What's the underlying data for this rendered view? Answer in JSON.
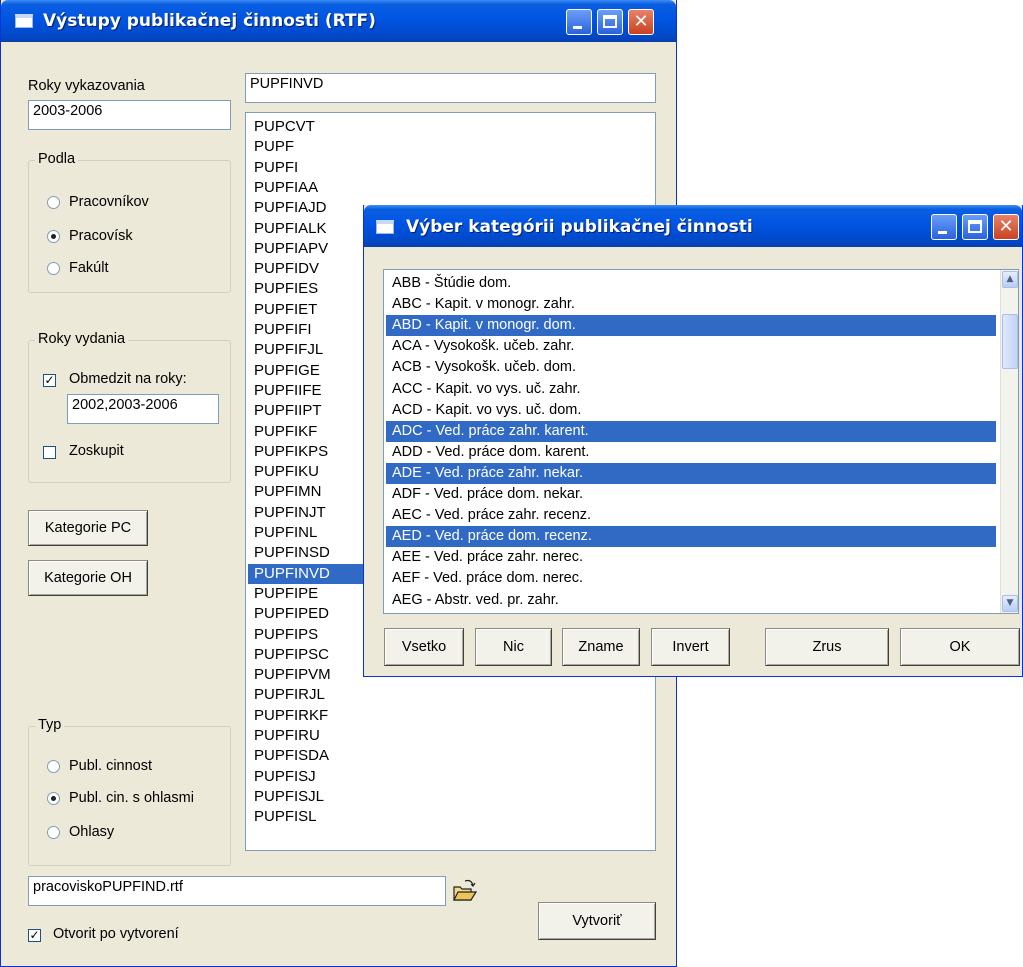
{
  "main_window": {
    "title": "Výstupy publikačnej činnosti (RTF)",
    "years_label": "Roky vykazovania",
    "years_value": "2003-2006",
    "podla": {
      "label": "Podla",
      "options": [
        "Pracovníkov",
        "Pracovísk",
        "Fakúlt"
      ],
      "selected": "Pracovísk"
    },
    "roky_vydania": {
      "label": "Roky vydania",
      "restrict_label": "Obmedzit na roky:",
      "restrict_checked": true,
      "restrict_value": "2002,2003-2006",
      "group_label": "Zoskupit",
      "group_checked": false
    },
    "buttons": {
      "kategorie_pc": "Kategorie PC",
      "kategorie_oh": "Kategorie OH",
      "create": "Vytvoriť"
    },
    "typ": {
      "label": "Typ",
      "options": [
        "Publ. cinnost",
        "Publ. cin. s ohlasmi",
        "Ohlasy"
      ],
      "selected": "Publ. cin. s ohlasmi"
    },
    "template_value": "PUPFINVD",
    "templates": [
      "PUPCVT",
      "PUPF",
      "PUPFI",
      "PUPFIAA",
      "PUPFIAJD",
      "PUPFIALK",
      "PUPFIAPV",
      "PUPFIDV",
      "PUPFIES",
      "PUPFIET",
      "PUPFIFI",
      "PUPFIFJL",
      "PUPFIGE",
      "PUPFIIFE",
      "PUPFIIPT",
      "PUPFIKF",
      "PUPFIKPS",
      "PUPFIKU",
      "PUPFIMN",
      "PUPFINJT",
      "PUPFINL",
      "PUPFINSD",
      "PUPFINVD",
      "PUPFIPE",
      "PUPFIPED",
      "PUPFIPS",
      "PUPFIPSC",
      "PUPFIPVM",
      "PUPFIRJL",
      "PUPFIRKF",
      "PUPFIRU",
      "PUPFISDA",
      "PUPFISJ",
      "PUPFISJL",
      "PUPFISL"
    ],
    "selected_template": "PUPFINVD",
    "output_file": "pracoviskoPUPFIND.rtf",
    "open_after_label": "Otvorit po vytvorení",
    "open_after_checked": true
  },
  "dialog": {
    "title": "Výber kategórii publikačnej činnosti",
    "items": [
      {
        "text": "ABB - Štúdie dom.",
        "selected": false
      },
      {
        "text": "ABC - Kapit. v monogr. zahr.",
        "selected": false
      },
      {
        "text": "ABD - Kapit. v monogr. dom.",
        "selected": true
      },
      {
        "text": "ACA - Vysokošk. učeb. zahr.",
        "selected": false
      },
      {
        "text": "ACB - Vysokošk. učeb. dom.",
        "selected": false
      },
      {
        "text": "ACC - Kapit. vo vys. uč. zahr.",
        "selected": false
      },
      {
        "text": "ACD - Kapit. vo vys. uč. dom.",
        "selected": false
      },
      {
        "text": "ADC - Ved. práce zahr. karent.",
        "selected": true
      },
      {
        "text": "ADD - Ved. práce dom. karent.",
        "selected": false
      },
      {
        "text": "ADE - Ved. práce zahr. nekar.",
        "selected": true
      },
      {
        "text": "ADF - Ved. práce dom. nekar.",
        "selected": false
      },
      {
        "text": "AEC - Ved. práce zahr. recenz.",
        "selected": false
      },
      {
        "text": "AED - Ved. práce dom. recenz.",
        "selected": true
      },
      {
        "text": "AEE - Ved. práce zahr. nerec.",
        "selected": false
      },
      {
        "text": "AEF - Ved. práce dom. nerec.",
        "selected": false
      },
      {
        "text": "AEG - Abstr. ved. pr. zahr.",
        "selected": false
      }
    ],
    "buttons": {
      "all": "Vsetko",
      "none": "Nic",
      "known": "Zname",
      "invert": "Invert",
      "cancel": "Zrus",
      "ok": "OK"
    }
  }
}
